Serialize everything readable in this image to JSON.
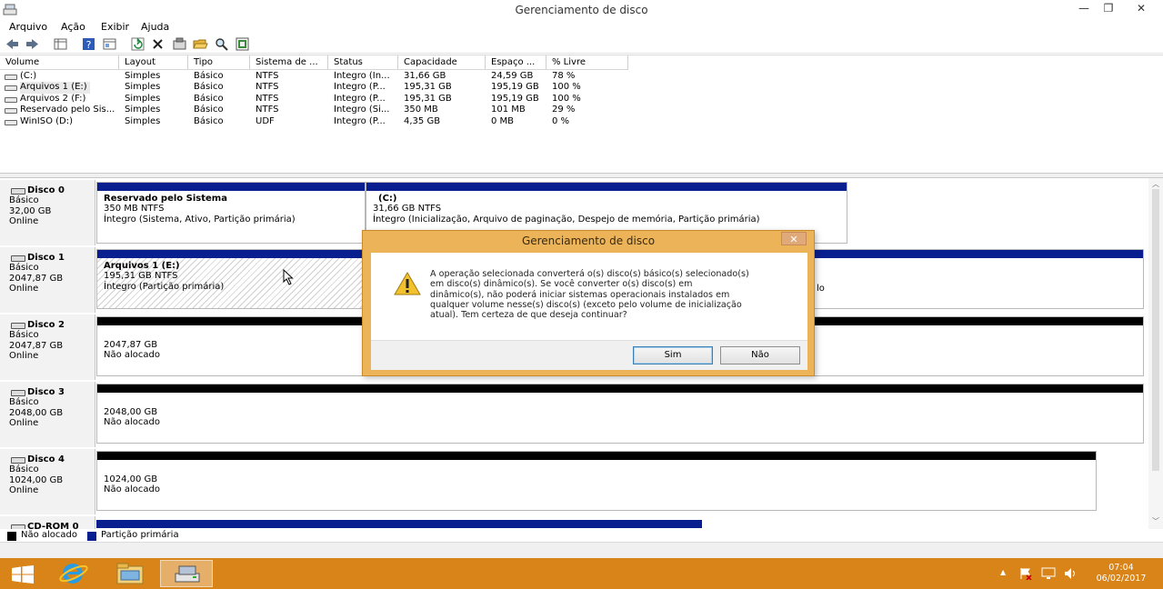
{
  "window": {
    "title": "Gerenciamento de disco",
    "minimize": "—",
    "maximize": "❐",
    "close": "✕"
  },
  "menu": [
    "Arquivo",
    "Ação",
    "Exibir",
    "Ajuda"
  ],
  "toolbar_icons": [
    "back-arrow-icon",
    "forward-arrow-icon",
    "console-tree-icon",
    "help-icon",
    "properties-icon",
    "refresh-icon",
    "delete-icon",
    "settings-icon",
    "open-folder-icon",
    "search-icon",
    "export-icon"
  ],
  "volume_list": {
    "columns": [
      "Volume",
      "Layout",
      "Tipo",
      "Sistema de ...",
      "Status",
      "Capacidade",
      "Espaço ...",
      "% Livre"
    ],
    "rows": [
      [
        "(C:)",
        "Simples",
        "Básico",
        "NTFS",
        "Íntegro (In...",
        "31,66 GB",
        "24,59 GB",
        "78 %"
      ],
      [
        "Arquivos 1 (E:)",
        "Simples",
        "Básico",
        "NTFS",
        "Íntegro (P...",
        "195,31 GB",
        "195,19 GB",
        "100 %"
      ],
      [
        "Arquivos 2 (F:)",
        "Simples",
        "Básico",
        "NTFS",
        "Íntegro (P...",
        "195,31 GB",
        "195,19 GB",
        "100 %"
      ],
      [
        "Reservado pelo Sis...",
        "Simples",
        "Básico",
        "NTFS",
        "Íntegro (Si...",
        "350 MB",
        "101 MB",
        "29 %"
      ],
      [
        "WinISO (D:)",
        "Simples",
        "Básico",
        "UDF",
        "Íntegro (P...",
        "4,35 GB",
        "0 MB",
        "0 %"
      ]
    ]
  },
  "disks": {
    "d0": {
      "name": "Disco 0",
      "type": "Básico",
      "size": "32,00 GB",
      "state": "Online",
      "p1": {
        "title": "Reservado pelo Sistema",
        "size": "350 MB NTFS",
        "status": "Íntegro (Sistema, Ativo, Partição primária)"
      },
      "p2": {
        "title": "(C:)",
        "size": "31,66 GB NTFS",
        "status": "Íntegro (Inicialização, Arquivo de paginação, Despejo de memória, Partição primária)"
      }
    },
    "d1": {
      "name": "Disco 1",
      "type": "Básico",
      "size": "2047,87 GB",
      "state": "Online",
      "p1": {
        "title": "Arquivos 1  (E:)",
        "size": "195,31 GB NTFS",
        "status": "Íntegro (Partição primária)"
      },
      "p2_fragment": "lo"
    },
    "d2": {
      "name": "Disco 2",
      "type": "Básico",
      "size": "2047,87 GB",
      "state": "Online",
      "p1": {
        "size": "2047,87 GB",
        "status": "Não alocado"
      }
    },
    "d3": {
      "name": "Disco 3",
      "type": "Básico",
      "size": "2048,00 GB",
      "state": "Online",
      "p1": {
        "size": "2048,00 GB",
        "status": "Não alocado"
      }
    },
    "d4": {
      "name": "Disco 4",
      "type": "Básico",
      "size": "1024,00 GB",
      "state": "Online",
      "p1": {
        "size": "1024,00 GB",
        "status": "Não alocado"
      }
    },
    "cd": {
      "name": "CD-ROM 0"
    }
  },
  "legend": {
    "unallocated": "Não alocado",
    "primary": "Partição primária"
  },
  "colors": {
    "primary": "#0a1f8f",
    "unallocated": "#000000",
    "taskbar": "#d88419",
    "dialog_frame": "#ecb358"
  },
  "dialog": {
    "title": "Gerenciamento de disco",
    "close": "✕",
    "icon": "warning-icon",
    "message": "A operação selecionada converterá o(s) disco(s) básico(s) selecionado(s) em disco(s) dinâmico(s). Se você converter o(s) disco(s) em dinâmico(s), não poderá iniciar sistemas operacionais instalados em qualquer volume nesse(s) disco(s) (exceto pelo volume de inicialização atual). Tem certeza de que deseja continuar?",
    "message_lines": [
      "A operação selecionada converterá o(s) disco(s) básico(s) selecionado(s)",
      "em disco(s) dinâmico(s). Se você converter o(s) disco(s) em",
      "dinâmico(s), não poderá iniciar sistemas operacionais instalados em",
      "qualquer volume nesse(s) disco(s) (exceto pelo volume de inicialização",
      "atual). Tem certeza de que deseja continuar?"
    ],
    "yes": "Sim",
    "no": "Não"
  },
  "taskbar": {
    "apps": [
      "start-icon",
      "internet-explorer-icon",
      "file-explorer-icon",
      "disk-management-icon"
    ],
    "tray_up": "▲",
    "time": "07:04",
    "date": "06/02/2017"
  }
}
